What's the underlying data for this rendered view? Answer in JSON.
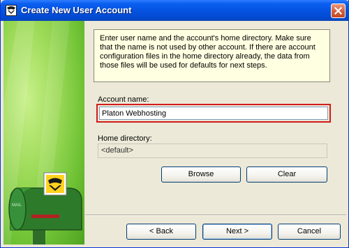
{
  "window": {
    "title": "Create New User Account"
  },
  "info": {
    "text": "Enter user name and the account's home directory. Make sure that the name is not used by other account. If there are account configuration files in the home directory already, the data from those files will be used for defaults for next steps."
  },
  "form": {
    "account_name_label": "Account name:",
    "account_name_value": "Platon Webhosting",
    "home_directory_label": "Home directory:",
    "home_directory_value": "<default>"
  },
  "buttons": {
    "browse": "Browse",
    "clear": "Clear",
    "back": "< Back",
    "next": "Next >",
    "cancel": "Cancel"
  },
  "colors": {
    "titlebar": "#0553e1",
    "info_bg": "#ffffe1",
    "highlight_border": "#d11c1c",
    "sidebar_green": "#6fc234"
  },
  "icons": {
    "title": "mailbox-icon",
    "close": "close-icon",
    "sidebar": "mailbox-illustration"
  }
}
